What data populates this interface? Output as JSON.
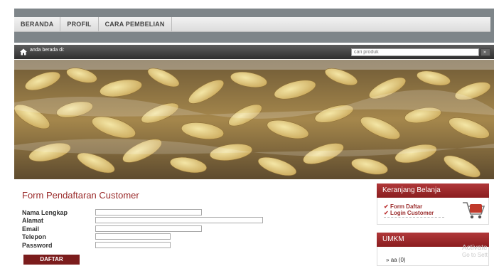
{
  "nav": {
    "items": [
      {
        "label": "BERANDA"
      },
      {
        "label": "PROFIL"
      },
      {
        "label": "CARA PEMBELIAN"
      }
    ]
  },
  "breadcrumb": {
    "label": "anda berada di:"
  },
  "search": {
    "placeholder": "cari produk"
  },
  "form": {
    "title": "Form Pendaftaran Customer",
    "fields": [
      {
        "label": "Nama Lengkap"
      },
      {
        "label": "Alamat"
      },
      {
        "label": "Email"
      },
      {
        "label": "Telepon"
      },
      {
        "label": "Password"
      }
    ],
    "submit_label": "DAFTAR"
  },
  "sidebar": {
    "cart": {
      "title": "Keranjang Belanja",
      "links": [
        {
          "label": "Form Daftar"
        },
        {
          "label": "Login Customer"
        }
      ]
    },
    "umkm": {
      "title": "UMKM",
      "items": [
        {
          "label": "aa (0)"
        }
      ]
    }
  },
  "watermark": {
    "line1": "Activate",
    "line2": "Go to Sett"
  },
  "colors": {
    "accent": "#8a1d1f",
    "title": "#9a2b2b"
  }
}
